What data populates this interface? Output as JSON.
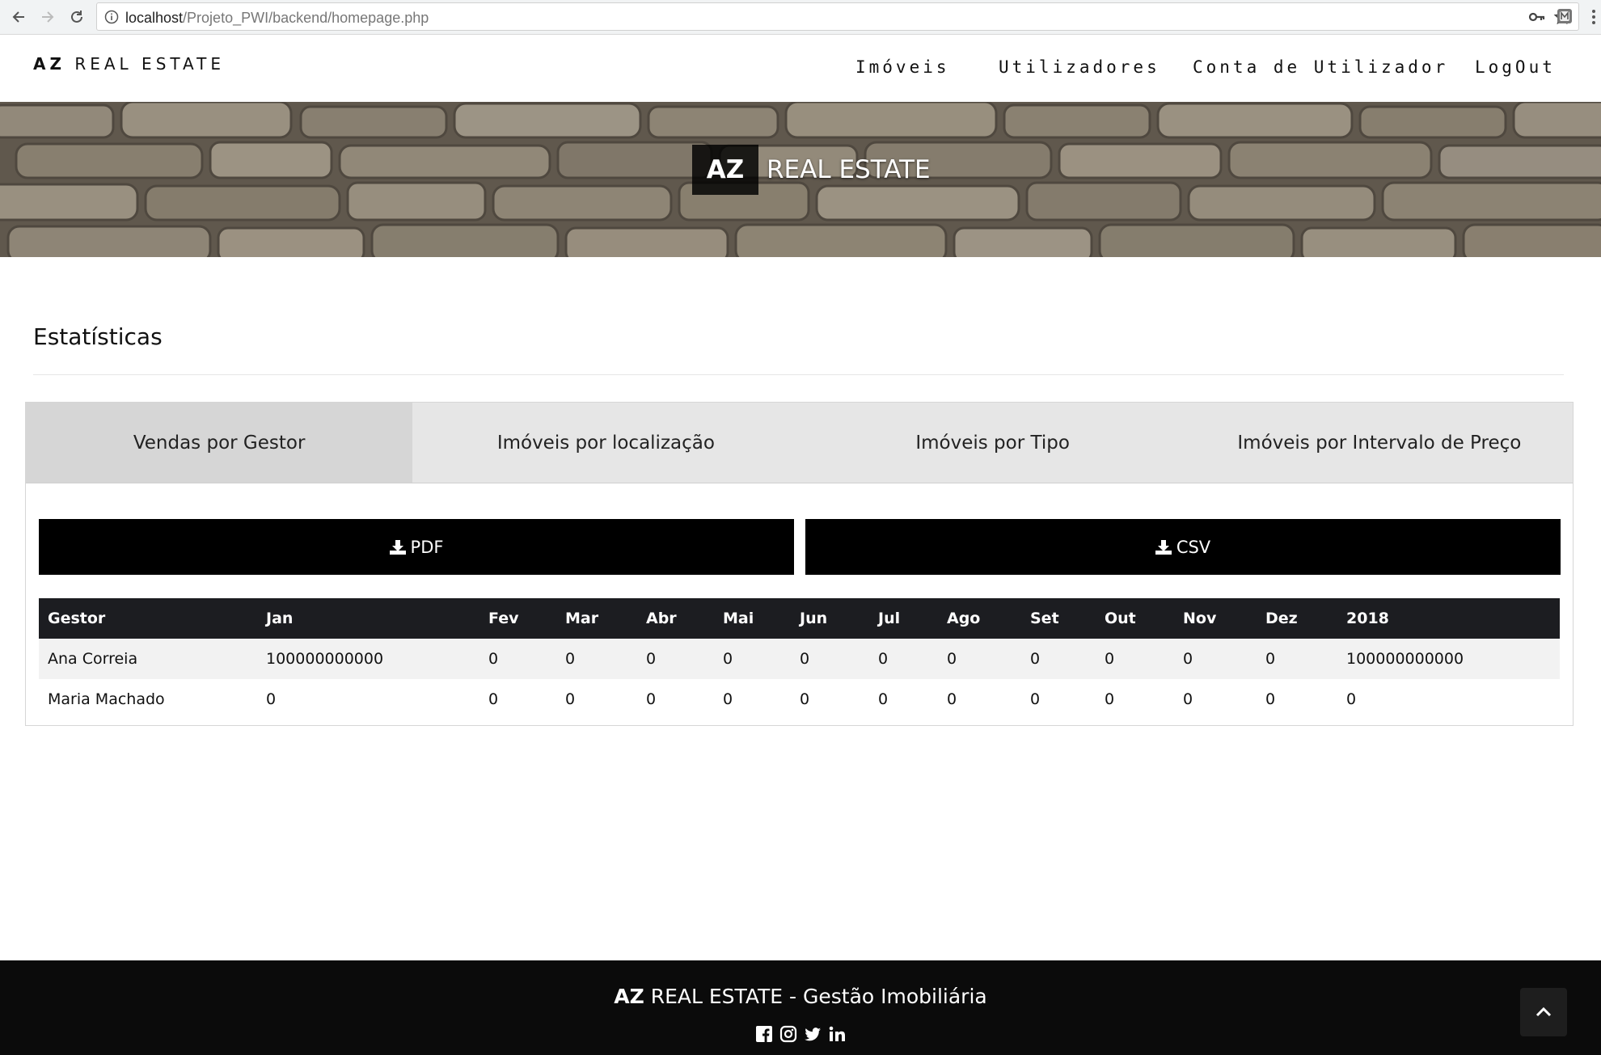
{
  "browser": {
    "url_host": "localhost",
    "url_path": "/Projeto_PWI/backend/homepage.php"
  },
  "header": {
    "logo_bold": "AZ",
    "logo_rest": "REAL ESTATE",
    "nav": [
      "Imóveis",
      "Utilizadores",
      "Conta de Utilizador",
      "LogOut"
    ]
  },
  "hero": {
    "brand_bold": "AZ",
    "brand_rest": "REAL ESTATE"
  },
  "section": {
    "title": "Estatísticas"
  },
  "tabs": [
    {
      "label": "Vendas por Gestor",
      "active": true
    },
    {
      "label": "Imóveis por localização",
      "active": false
    },
    {
      "label": "Imóveis por Tipo",
      "active": false
    },
    {
      "label": "Imóveis por Intervalo de Preço",
      "active": false
    }
  ],
  "buttons": {
    "pdf": "PDF",
    "csv": "CSV",
    "icon": "download-icon"
  },
  "table": {
    "headers": [
      "Gestor",
      "Jan",
      "Fev",
      "Mar",
      "Abr",
      "Mai",
      "Jun",
      "Jul",
      "Ago",
      "Set",
      "Out",
      "Nov",
      "Dez",
      "2018"
    ],
    "rows": [
      [
        "Ana Correia",
        "100000000000",
        "0",
        "0",
        "0",
        "0",
        "0",
        "0",
        "0",
        "0",
        "0",
        "0",
        "0",
        "100000000000"
      ],
      [
        "Maria Machado",
        "0",
        "0",
        "0",
        "0",
        "0",
        "0",
        "0",
        "0",
        "0",
        "0",
        "0",
        "0",
        "0"
      ]
    ]
  },
  "footer": {
    "brand_bold": "AZ",
    "brand_rest": "REAL ESTATE - Gestão Imobiliária",
    "social_icons": [
      "facebook-icon",
      "instagram-icon",
      "twitter-icon",
      "linkedin-icon"
    ]
  },
  "colors": {
    "table_header_bg": "#1c1d21",
    "button_bg": "#000000",
    "tab_bg": "#e6e6e6",
    "tab_active_bg": "#d6d6d6",
    "footer_bg": "#0b0b0b"
  }
}
